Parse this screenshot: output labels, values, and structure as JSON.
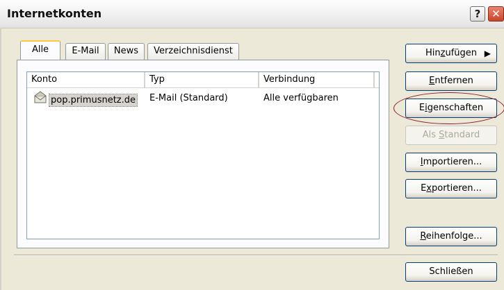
{
  "window": {
    "title": "Internetkonten"
  },
  "titlebar_buttons": {
    "help": "?",
    "close": "✕"
  },
  "tabs": [
    {
      "label": "Alle",
      "active": true
    },
    {
      "label": "E-Mail",
      "active": false
    },
    {
      "label": "News",
      "active": false
    },
    {
      "label": "Verzeichnisdienst",
      "active": false
    }
  ],
  "listview": {
    "columns": [
      "Konto",
      "Typ",
      "Verbindung"
    ],
    "rows": [
      {
        "konto": "pop.primusnetz.de",
        "typ": "E-Mail (Standard)",
        "verbindung": "Alle verfügbaren",
        "icon": "mail-account-icon",
        "selected": true
      }
    ]
  },
  "buttons": {
    "hinzufuegen": {
      "pre": "Hin",
      "key": "z",
      "post": "ufügen",
      "arrow": "▶"
    },
    "entfernen": {
      "pre": "",
      "key": "E",
      "post": "ntfernen"
    },
    "eigenschaften": {
      "pre": "E",
      "key": "i",
      "post": "genschaften"
    },
    "als_standard": {
      "pre": "Als ",
      "key": "S",
      "post": "tandard",
      "disabled": true
    },
    "importieren": {
      "pre": "",
      "key": "I",
      "post": "mportieren..."
    },
    "exportieren": {
      "pre": "E",
      "key": "x",
      "post": "portieren..."
    },
    "reihenfolge": {
      "pre": "",
      "key": "R",
      "post": "eihenfolge..."
    },
    "schliessen": {
      "label": "Schließen"
    }
  },
  "colors": {
    "highlight_ellipse": "#8b1c2a",
    "window_bg": "#ece9d8",
    "button_border": "#003c74"
  }
}
